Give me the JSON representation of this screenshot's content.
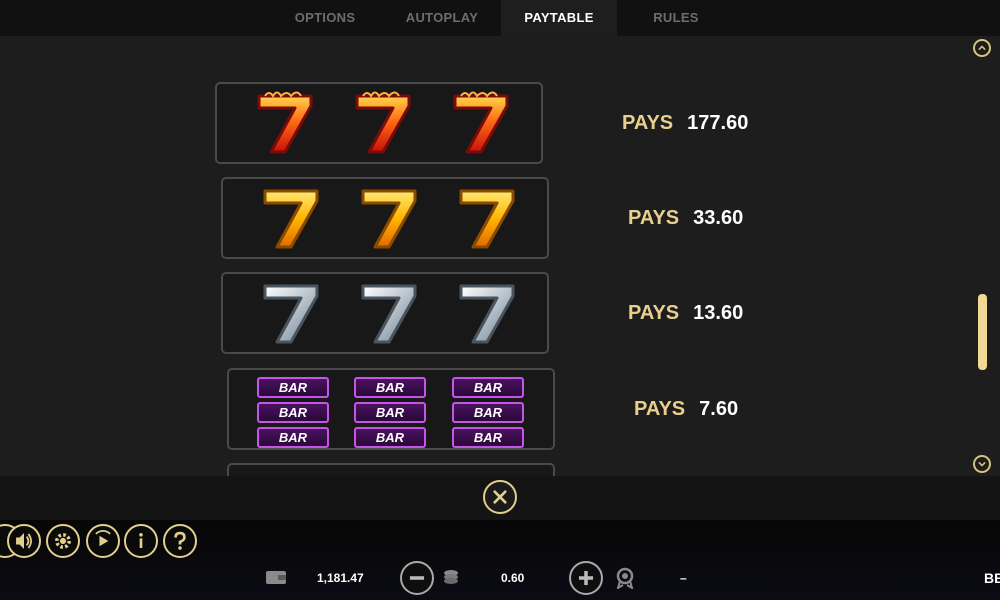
{
  "tabs": [
    {
      "label": "OPTIONS",
      "active": false
    },
    {
      "label": "AUTOPLAY",
      "active": false
    },
    {
      "label": "PAYTABLE",
      "active": true
    },
    {
      "label": "RULES",
      "active": false
    }
  ],
  "paytable": {
    "rows": [
      {
        "symbol": "red-flaming-seven-icon",
        "count": 3,
        "pays_label": "PAYS",
        "pays_value": "177.60"
      },
      {
        "symbol": "gold-seven-icon",
        "count": 3,
        "pays_label": "PAYS",
        "pays_value": "33.60"
      },
      {
        "symbol": "silver-seven-icon",
        "count": 3,
        "pays_label": "PAYS",
        "pays_value": "13.60"
      },
      {
        "symbol": "triple-bar-icon",
        "count": 3,
        "bar_text": "BAR",
        "pays_label": "PAYS",
        "pays_value": "7.60"
      }
    ]
  },
  "scroll": {
    "up_icon": "chevron-up-icon",
    "down_icon": "chevron-down-icon",
    "position": 0.62
  },
  "close": {
    "icon": "close-icon"
  },
  "bottom_bar": {
    "balance": "1,181.47",
    "bet": "0.60",
    "win": "–",
    "brand_fragment": "BE",
    "icons": [
      "sound-icon",
      "settings-gear-icon",
      "autoplay-icon",
      "info-icon",
      "help-icon",
      "wallet-icon",
      "coin-stack-icon",
      "award-icon"
    ]
  },
  "colors": {
    "accent_gold": "#e3cf8d",
    "pays_label": "#e8cf8c",
    "bar_purple": "#c455e6",
    "background": "#1d1d1d"
  }
}
